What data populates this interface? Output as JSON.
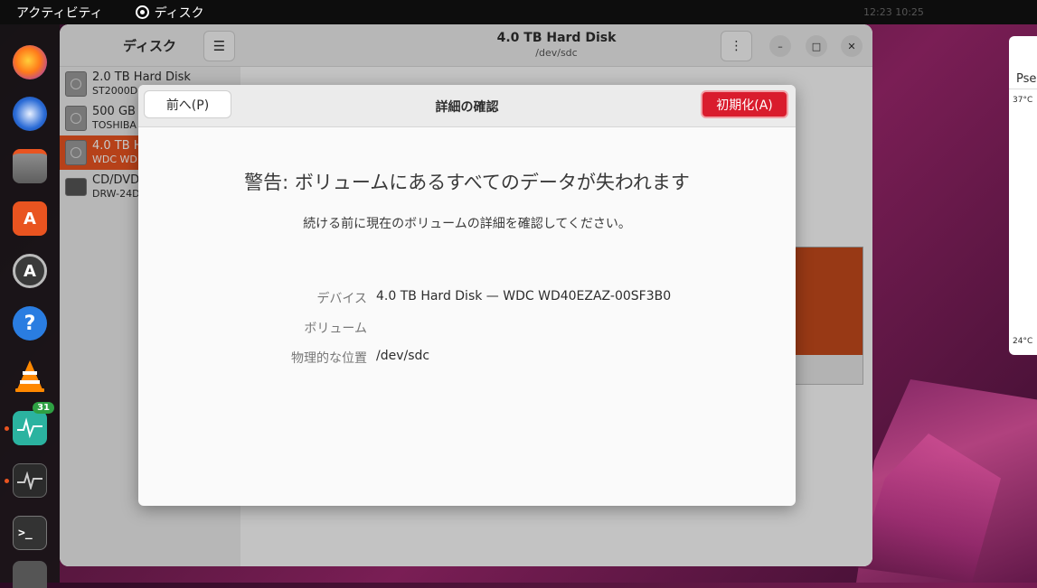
{
  "topbar": {
    "activities": "アクティビティ",
    "app_name": "ディスク",
    "clock": "12:23  10:25"
  },
  "dock": {
    "items": [
      "firefox-icon",
      "thunderbird-icon",
      "files-icon",
      "app-center-icon",
      "software-updater-icon",
      "help-icon",
      "vlc-icon",
      "resource-monitor-icon",
      "system-monitor-icon",
      "terminal-icon",
      "show-apps-icon"
    ],
    "badge_count": "31"
  },
  "sidebar": {
    "title": "ディスク",
    "menu_icon": "☰",
    "disks": [
      {
        "name": "2.0 TB Hard Disk",
        "sub": "ST2000D"
      },
      {
        "name": "500 GB",
        "sub": "TOSHIBA"
      },
      {
        "name": "4.0 TB H",
        "sub": "WDC WD"
      },
      {
        "name": "CD/DVD",
        "sub": "DRW-24D"
      }
    ]
  },
  "main": {
    "title": "4.0 TB Hard Disk",
    "subtitle": "/dev/sdc",
    "more_icon": "⋮",
    "minimize": "–",
    "maximize": "□",
    "close": "✕"
  },
  "right_panel": {
    "label": "Pse",
    "temp_high": "37°C",
    "temp_low": "24°C"
  },
  "dialog": {
    "back_label": "前へ(P)",
    "title": "詳細の確認",
    "format_label": "初期化(A)",
    "warning": "警告: ボリュームにあるすべてのデータが失われます",
    "description": "続ける前に現在のボリュームの詳細を確認してください。",
    "details": [
      {
        "label": "デバイス",
        "value": "4.0 TB Hard Disk — WDC WD40EZAZ-00SF3B0"
      },
      {
        "label": "ボリューム",
        "value": ""
      },
      {
        "label": "物理的な位置",
        "value": "/dev/sdc"
      }
    ]
  },
  "colors": {
    "accent": "#e95420",
    "destructive": "#d91c2d"
  }
}
